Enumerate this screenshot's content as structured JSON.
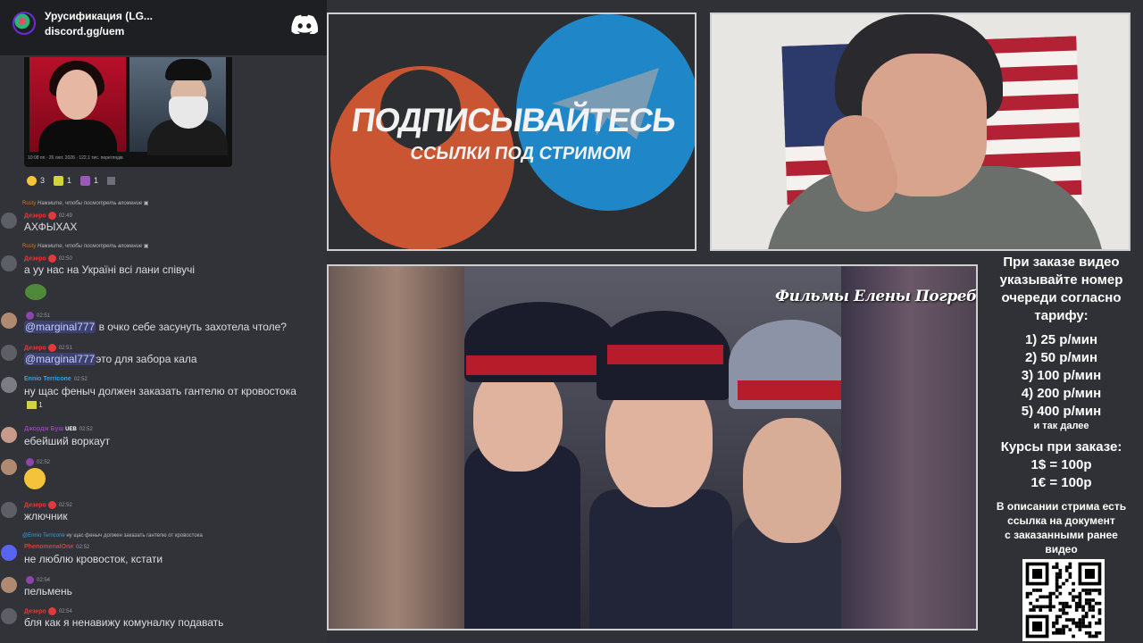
{
  "server": {
    "name": "Урусификация (LG...",
    "invite": "discord.gg/uem"
  },
  "embed": {
    "meta": "10:08 пп · 26 лют. 2026 · 122,1 тис. переглядів"
  },
  "reactions": [
    {
      "icon": "grimace-emoji",
      "count": "3"
    },
    {
      "icon": "true-sticker-emoji",
      "count": "1"
    },
    {
      "icon": "tag-emoji",
      "count": "1"
    }
  ],
  "messages": [
    {
      "reply_user": "Rusty",
      "reply_text": "Нажмите, чтобы посмотреть вложение",
      "user": "Дезеро",
      "time": "02:49",
      "text": "АХФЫХАХ"
    },
    {
      "reply_user": "Rusty",
      "reply_text": "Нажмите, чтобы посмотреть вложение",
      "user": "Дезеро",
      "time": "02:50",
      "text": "а уу нас на Україні всі лани співучі"
    },
    {
      "user": "",
      "time": "02:51",
      "mention": "@marginal777",
      "text": " в очко себе засунуть захотела чтоле?"
    },
    {
      "user": "Дезеро",
      "time": "02:51",
      "mention": "@marginal777",
      "text": "это для забора кала"
    },
    {
      "user": "Ennio Terricone",
      "time": "02:52",
      "text": "ну щас феныч должен заказать гантелю от кровостока",
      "reaction_count": "1"
    },
    {
      "user": "Джордж Буш",
      "tag": "UEB",
      "time": "02:52",
      "text": "ебейший воркаут"
    },
    {
      "user": "",
      "time": "02:52",
      "text": ""
    },
    {
      "user": "Дезеро",
      "time": "02:52",
      "text": "жлючник"
    },
    {
      "reply_user": "@Ennio Terricone",
      "reply_text": "ну щас феныч должен заказать гантелю от кровостока",
      "user": "PhenomenalOne",
      "time": "02:52",
      "text": "не люблю кровосток, кстати"
    },
    {
      "user": "",
      "time": "02:54",
      "text": "пельмень"
    },
    {
      "user": "Дезеро",
      "time": "02:54",
      "text": "бля как я ненавижу комуналку подавать"
    }
  ],
  "promo": {
    "title": "ПОДПИСЫВАЙТЕСЬ",
    "subtitle": "ССЫЛКИ ПОД СТРИМОМ"
  },
  "video": {
    "caption": "Фильмы Елены Погребижской"
  },
  "info": {
    "intro": [
      "При заказе видео",
      "указывайте номер",
      "очереди согласно",
      "тарифу:"
    ],
    "tariffs": [
      "1) 25 р/мин",
      "2) 50 р/мин",
      "3) 100 р/мин",
      "4) 200 р/мин",
      "5) 400 р/мин"
    ],
    "tariffs_more": "и так далее",
    "rates_title": "Курсы при заказе:",
    "rates": [
      "1$ = 100р",
      "1€ = 100р"
    ],
    "doc_note": [
      "В описании стрима есть",
      "ссылка на документ",
      "с заказанными ранее",
      "видео"
    ]
  },
  "colors": {
    "accent_red": "#e03b3b",
    "discord_bg": "#313338",
    "telegram_blue": "#1f86c8",
    "boosty_orange": "#c95532"
  }
}
